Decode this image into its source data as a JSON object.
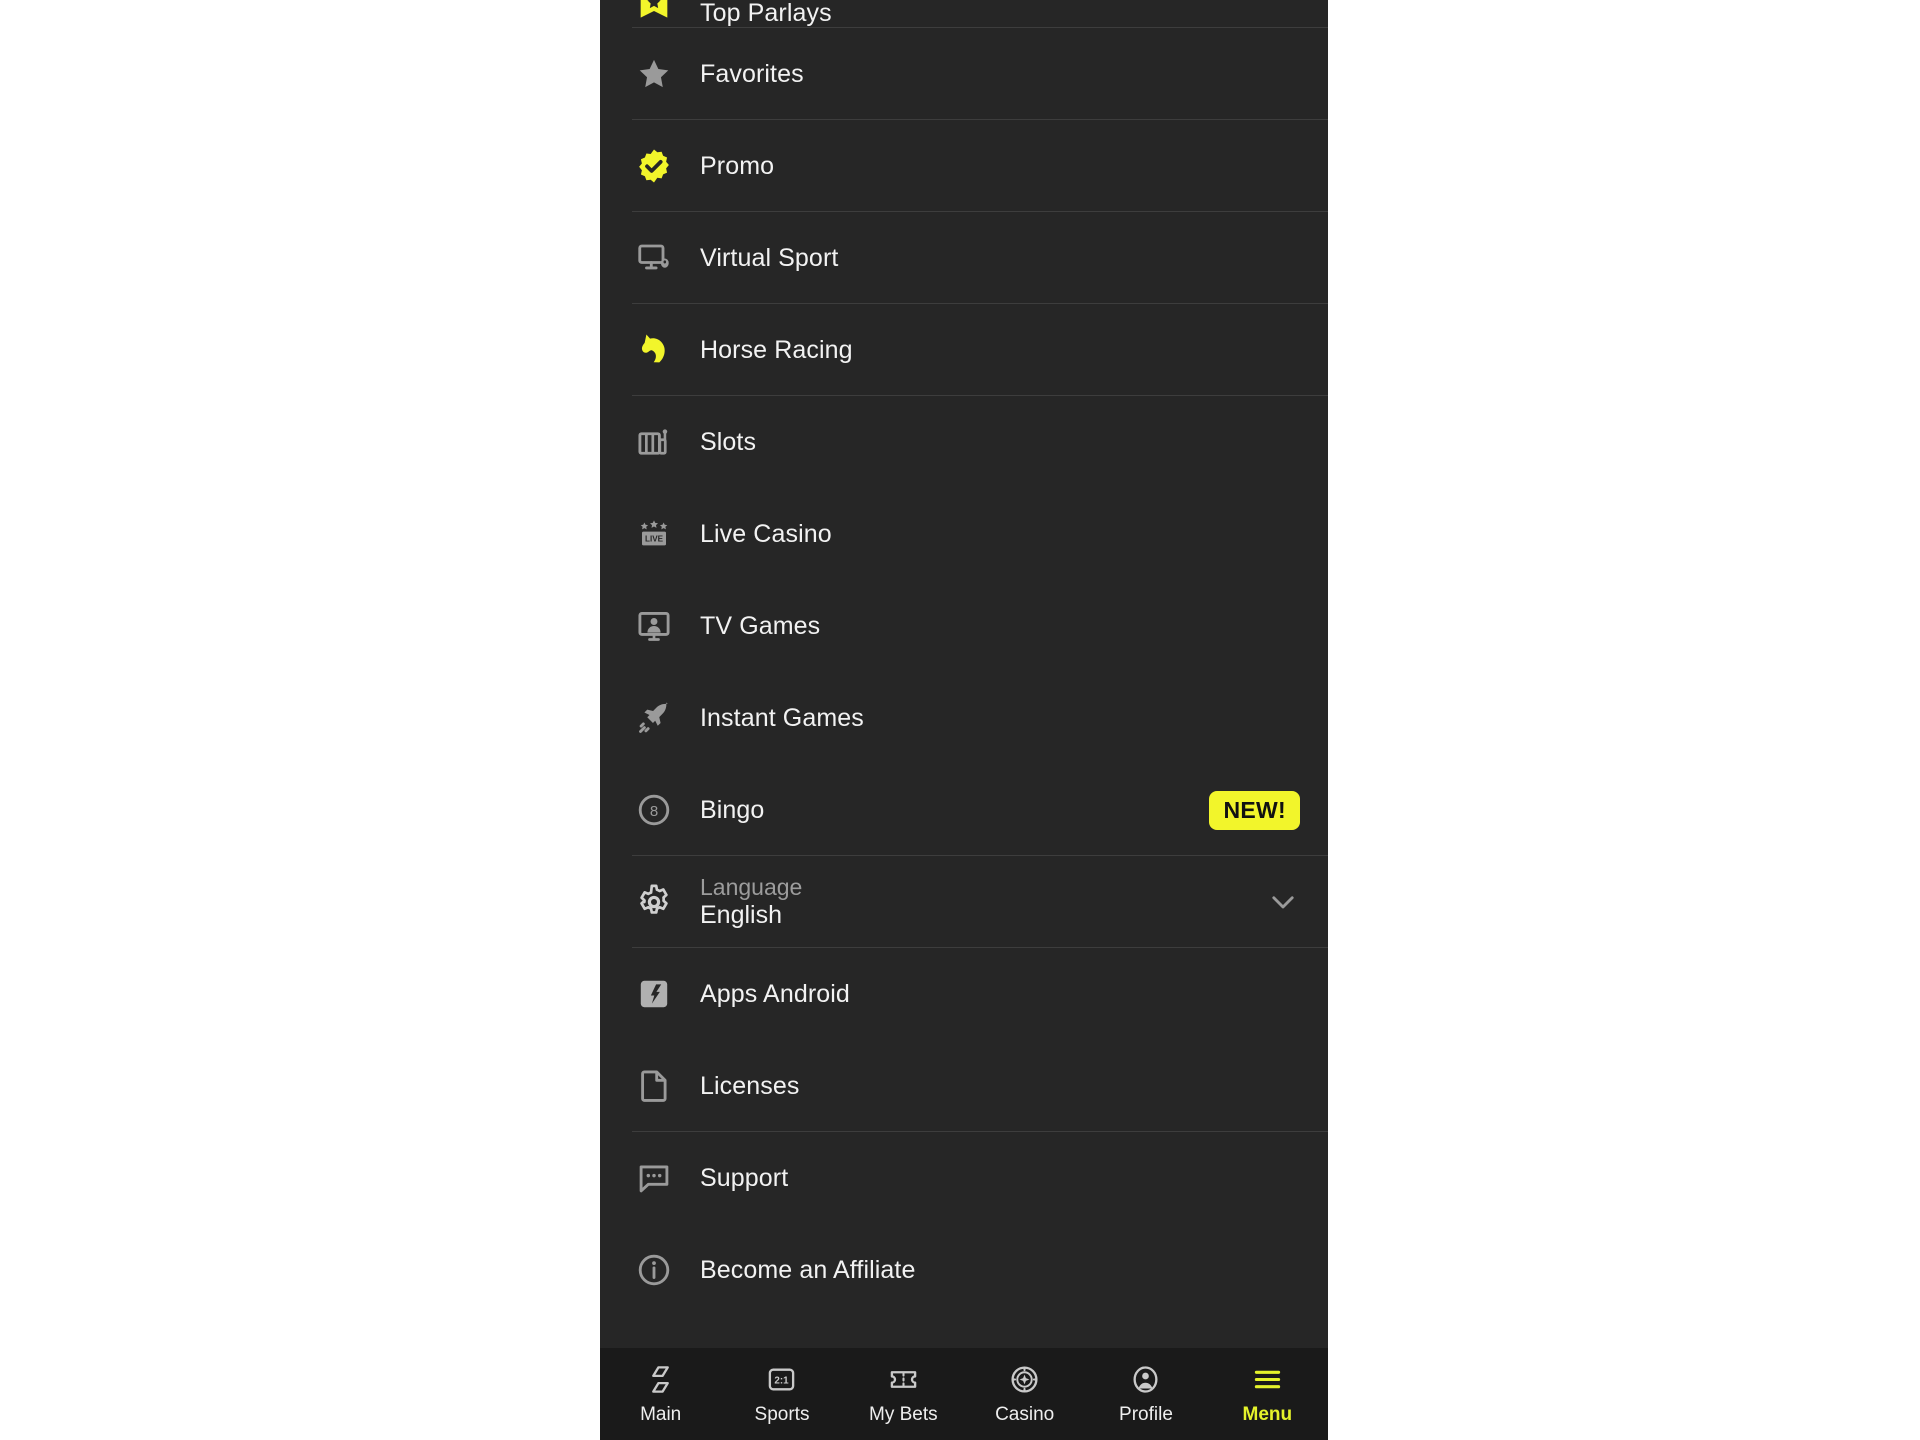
{
  "theme": {
    "panel_bg": "#262626",
    "nav_bg": "#1a1a1a",
    "accent_yellow": "#e4f22b",
    "icon_yellow": "#f2f52b",
    "icon_gray": "#9a9a9a",
    "text_white": "#f2f2f2",
    "text_muted": "#9c9c9c",
    "divider": "#3d3d3d"
  },
  "menu": {
    "items": [
      {
        "id": "top-parlays",
        "label": "Top Parlays",
        "icon": "bookmark-star-icon",
        "icon_color": "yellow",
        "clipped": true,
        "divider_below": true,
        "badge": null
      },
      {
        "id": "favorites",
        "label": "Favorites",
        "icon": "star-icon",
        "icon_color": "gray",
        "clipped": false,
        "divider_below": true,
        "badge": null
      },
      {
        "id": "promo",
        "label": "Promo",
        "icon": "promo-badge-icon",
        "icon_color": "yellow",
        "clipped": false,
        "divider_below": true,
        "badge": null
      },
      {
        "id": "virtual-sport",
        "label": "Virtual Sport",
        "icon": "monitor-icon",
        "icon_color": "gray",
        "clipped": false,
        "divider_below": true,
        "badge": null
      },
      {
        "id": "horse-racing",
        "label": "Horse Racing",
        "icon": "horse-head-icon",
        "icon_color": "yellow",
        "clipped": false,
        "divider_below": true,
        "badge": null
      },
      {
        "id": "slots",
        "label": "Slots",
        "icon": "slot-machine-icon",
        "icon_color": "gray",
        "clipped": false,
        "divider_below": false,
        "badge": null
      },
      {
        "id": "live-casino",
        "label": "Live Casino",
        "icon": "live-casino-icon",
        "icon_color": "gray",
        "clipped": false,
        "divider_below": false,
        "badge": null
      },
      {
        "id": "tv-games",
        "label": "TV Games",
        "icon": "tv-games-icon",
        "icon_color": "gray",
        "clipped": false,
        "divider_below": false,
        "badge": null
      },
      {
        "id": "instant-games",
        "label": "Instant Games",
        "icon": "rocket-icon",
        "icon_color": "gray",
        "clipped": false,
        "divider_below": false,
        "badge": null
      },
      {
        "id": "bingo",
        "label": "Bingo",
        "icon": "bingo-ball-icon",
        "icon_color": "gray",
        "clipped": false,
        "divider_below": true,
        "badge": "NEW!"
      }
    ],
    "language": {
      "title": "Language",
      "value": "English",
      "icon": "gear-icon",
      "chevron": "chevron-down-icon"
    },
    "items_after_language": [
      {
        "id": "apps-android",
        "label": "Apps Android",
        "icon": "android-app-icon",
        "icon_color": "gray",
        "divider_below": false
      },
      {
        "id": "licenses",
        "label": "Licenses",
        "icon": "document-icon",
        "icon_color": "gray",
        "divider_below": true
      },
      {
        "id": "support",
        "label": "Support",
        "icon": "chat-bubble-icon",
        "icon_color": "gray",
        "divider_below": false
      },
      {
        "id": "become-an-affiliate",
        "label": "Become an Affiliate",
        "icon": "info-circle-icon",
        "icon_color": "gray",
        "divider_below": false
      }
    ]
  },
  "bottom_nav": {
    "items": [
      {
        "id": "main",
        "label": "Main",
        "icon": "parallelograms-icon",
        "active": false
      },
      {
        "id": "sports",
        "label": "Sports",
        "icon": "odds-square-icon",
        "active": false
      },
      {
        "id": "my-bets",
        "label": "My Bets",
        "icon": "ticket-icon",
        "active": false
      },
      {
        "id": "casino",
        "label": "Casino",
        "icon": "casino-chip-icon",
        "active": false
      },
      {
        "id": "profile",
        "label": "Profile",
        "icon": "person-circle-icon",
        "active": false
      },
      {
        "id": "menu",
        "label": "Menu",
        "icon": "hamburger-icon",
        "active": true
      }
    ]
  }
}
